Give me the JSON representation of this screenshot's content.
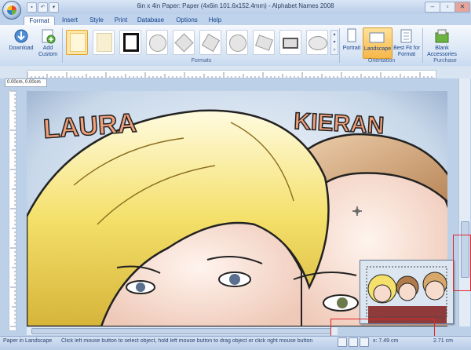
{
  "window": {
    "title": "6in x 4in Paper: Paper (4x6in 101.6x152.4mm) - Alphabet Names 2008"
  },
  "tabs": [
    {
      "label": "Format",
      "active": true
    },
    {
      "label": "Insert"
    },
    {
      "label": "Style"
    },
    {
      "label": "Print"
    },
    {
      "label": "Database"
    },
    {
      "label": "Options"
    },
    {
      "label": "Help"
    }
  ],
  "ribbon": {
    "download_label": "Download",
    "add_custom_label": "Add Custom",
    "formats_group": "Formats",
    "portrait_label": "Portrait",
    "landscape_label": "Landscape",
    "bestfit_label": "Best Fit for Format",
    "orientation_group": "Orientation",
    "blank_label": "Blank Accessories",
    "purchase_group": "Purchase"
  },
  "canvas": {
    "coord_label": "0.00cm, 0.00cm",
    "name_left": "LAURA",
    "name_right": "KIERAN"
  },
  "status": {
    "text": "Paper in Landscape",
    "hint": "Click left mouse button to select object, hold left mouse button to drag object or click right mouse button",
    "x": "x: 7.49 cm",
    "y": "2.71 cm"
  },
  "colors": {
    "accent": "#15428b",
    "highlight": "#e0252b",
    "selected": "#fde6a8"
  },
  "icons": [
    "office-orb-icon",
    "save-icon",
    "undo-icon",
    "minimize-icon",
    "maximize-icon",
    "close-icon",
    "download-icon",
    "add-icon",
    "portrait-icon",
    "landscape-icon",
    "bestfit-icon",
    "blank-accessories-icon"
  ]
}
